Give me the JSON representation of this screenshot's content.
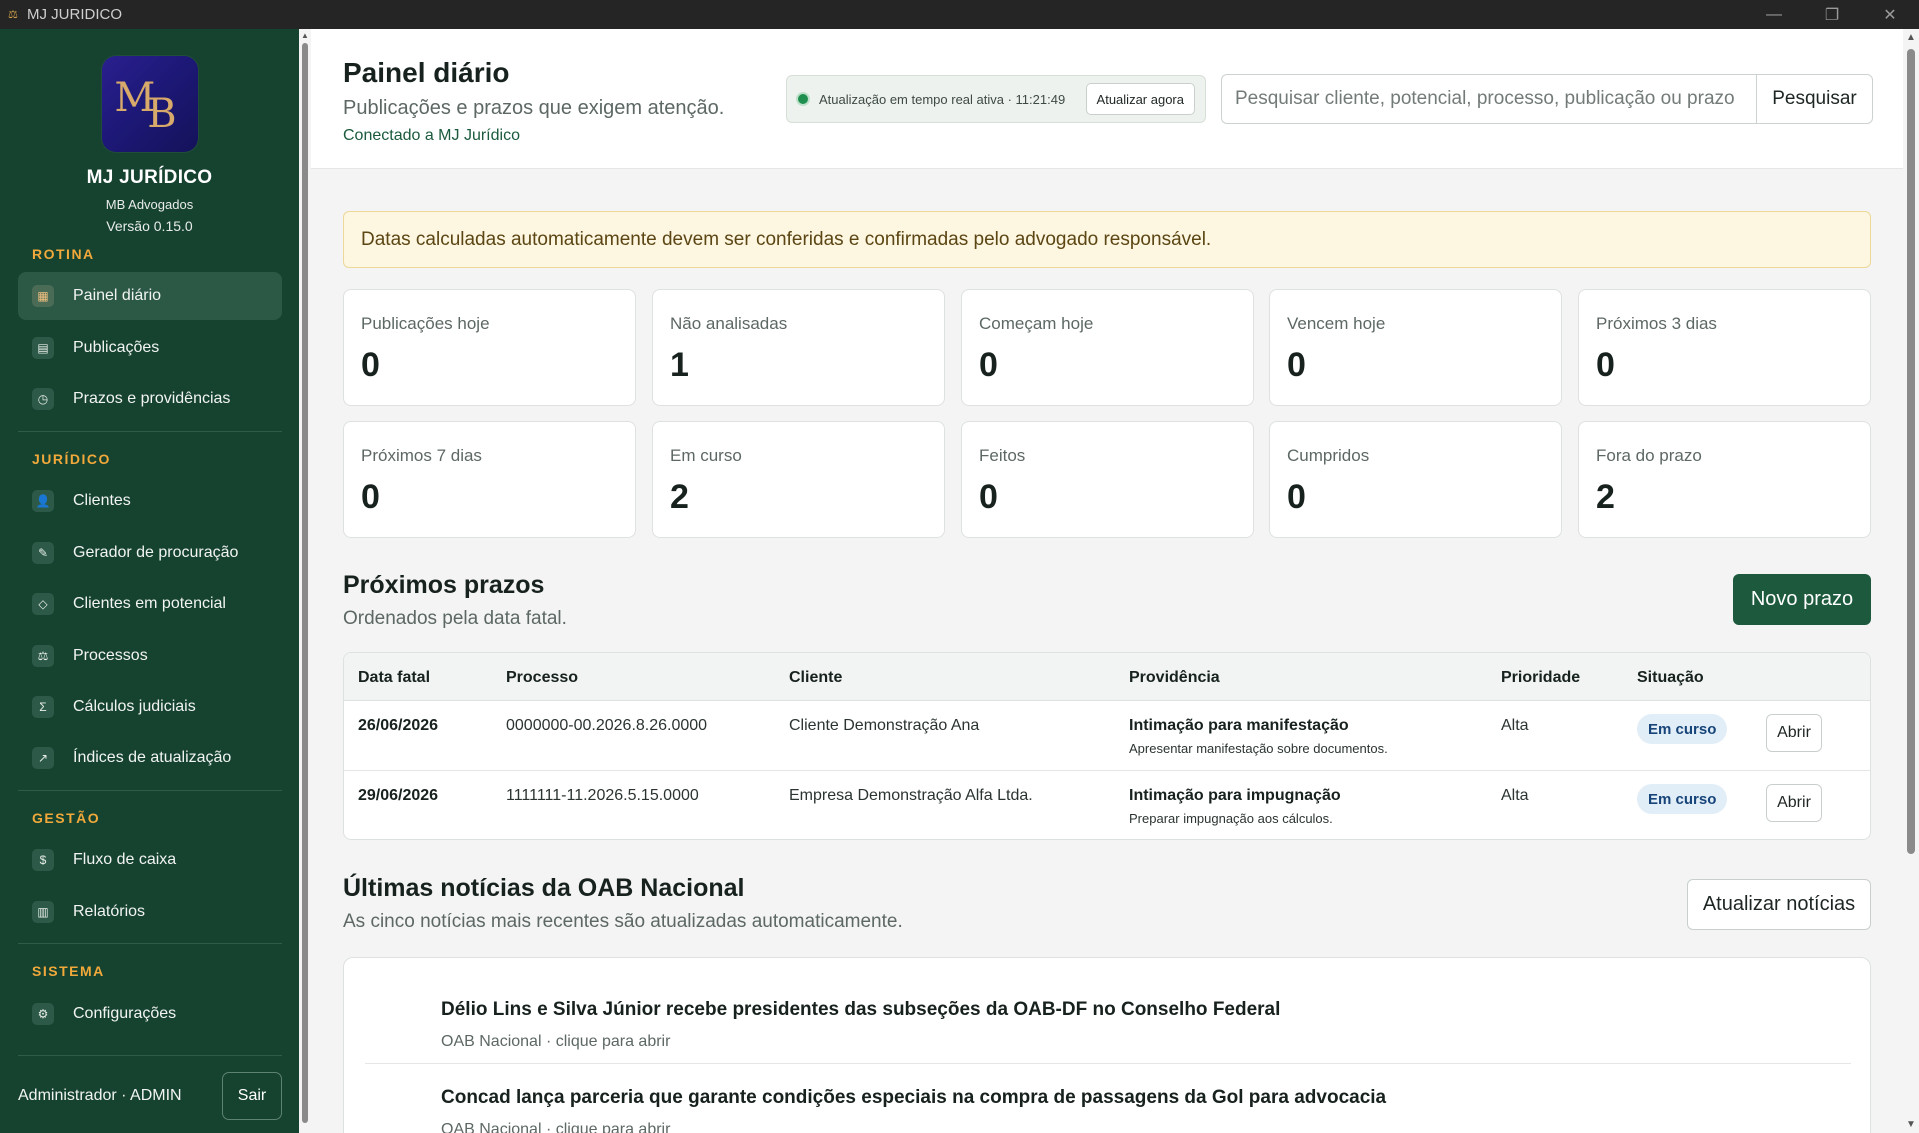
{
  "window": {
    "title": "MJ JURIDICO",
    "minimize": "—",
    "restore": "❐",
    "close": "✕"
  },
  "brand": {
    "logo_m": "M",
    "logo_b": "B",
    "name": "MJ JURÍDICO",
    "firm": "MB Advogados",
    "version": "Versão 0.15.0"
  },
  "nav": {
    "sections": {
      "rotina": "ROTINA",
      "juridico": "JURÍDICO",
      "gestao": "GESTÃO",
      "sistema": "SISTEMA"
    },
    "items": {
      "painel": {
        "label": "Painel diário",
        "icon": "▦"
      },
      "publicacoes": {
        "label": "Publicações",
        "icon": "▤"
      },
      "prazos": {
        "label": "Prazos e providências",
        "icon": "◷"
      },
      "clientes": {
        "label": "Clientes",
        "icon": "👤"
      },
      "procuracao": {
        "label": "Gerador de procuração",
        "icon": "✎"
      },
      "potencial": {
        "label": "Clientes em potencial",
        "icon": "◇"
      },
      "processos": {
        "label": "Processos",
        "icon": "⚖"
      },
      "calculos": {
        "label": "Cálculos judiciais",
        "icon": "Σ"
      },
      "indices": {
        "label": "Índices de atualização",
        "icon": "↗"
      },
      "fluxo": {
        "label": "Fluxo de caixa",
        "icon": "$"
      },
      "relatorios": {
        "label": "Relatórios",
        "icon": "▥"
      },
      "configuracoes": {
        "label": "Configurações",
        "icon": "⚙"
      }
    }
  },
  "user": {
    "label": "Administrador · ADMIN",
    "logout": "Sair"
  },
  "header": {
    "title": "Painel diário",
    "subtitle": "Publicações e prazos que exigem atenção.",
    "connected": "Conectado a MJ Jurídico",
    "realtime_status": "Atualização em tempo real ativa · 11:21:49",
    "refresh_now": "Atualizar agora",
    "search_placeholder": "Pesquisar cliente, potencial, processo, publicação ou prazo",
    "search_button": "Pesquisar"
  },
  "alert": "Datas calculadas automaticamente devem ser conferidas e confirmadas pelo advogado responsável.",
  "stats": [
    {
      "label": "Publicações hoje",
      "value": "0"
    },
    {
      "label": "Não analisadas",
      "value": "1"
    },
    {
      "label": "Começam hoje",
      "value": "0"
    },
    {
      "label": "Vencem hoje",
      "value": "0"
    },
    {
      "label": "Próximos 3 dias",
      "value": "0"
    },
    {
      "label": "Próximos 7 dias",
      "value": "0"
    },
    {
      "label": "Em curso",
      "value": "2"
    },
    {
      "label": "Feitos",
      "value": "0"
    },
    {
      "label": "Cumpridos",
      "value": "0"
    },
    {
      "label": "Fora do prazo",
      "value": "2"
    }
  ],
  "deadlines": {
    "title": "Próximos prazos",
    "subtitle": "Ordenados pela data fatal.",
    "new_button": "Novo prazo",
    "columns": [
      "Data fatal",
      "Processo",
      "Cliente",
      "Providência",
      "Prioridade",
      "Situação"
    ],
    "rows": [
      {
        "date": "26/06/2026",
        "process": "0000000-00.2026.8.26.0000",
        "client": "Cliente Demonstração Ana",
        "action_title": "Intimação para manifestação",
        "action_desc": "Apresentar manifestação sobre documentos.",
        "priority": "Alta",
        "status": "Em curso",
        "open": "Abrir"
      },
      {
        "date": "29/06/2026",
        "process": "1111111-11.2026.5.15.0000",
        "client": "Empresa Demonstração Alfa Ltda.",
        "action_title": "Intimação para impugnação",
        "action_desc": "Preparar impugnação aos cálculos.",
        "priority": "Alta",
        "status": "Em curso",
        "open": "Abrir"
      }
    ]
  },
  "news": {
    "title": "Últimas notícias da OAB Nacional",
    "subtitle": "As cinco notícias mais recentes são atualizadas automaticamente.",
    "refresh_button": "Atualizar notícias",
    "items": [
      {
        "title": "Délio Lins e Silva Júnior recebe presidentes das subseções da OAB-DF no Conselho Federal",
        "meta": "OAB Nacional · clique para abrir"
      },
      {
        "title": "Concad lança parceria que garante condições especiais na compra de passagens da Gol para advocacia",
        "meta": "OAB Nacional · clique para abrir"
      }
    ]
  }
}
